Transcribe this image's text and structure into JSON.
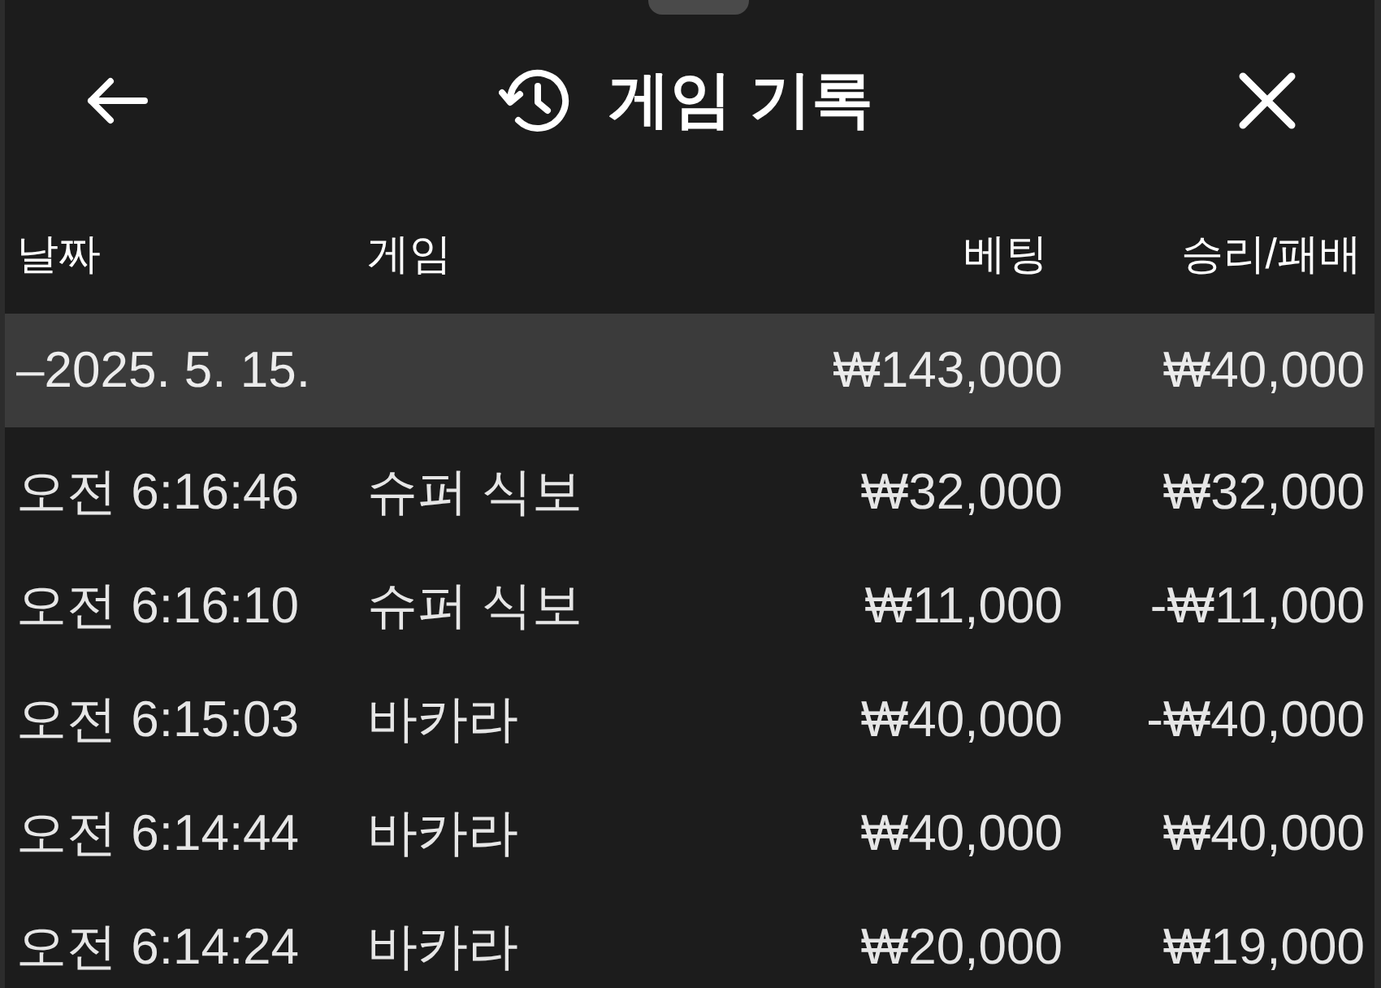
{
  "header": {
    "title": "게임 기록"
  },
  "table": {
    "columns": [
      "날짜",
      "게임",
      "베팅",
      "승리/패배"
    ],
    "groups": [
      {
        "date": "–2025. 5. 15.",
        "bet_total": "₩143,000",
        "result_total": "₩40,000",
        "expanded": true,
        "rows": [
          {
            "time": "오전 6:16:46",
            "game": "슈퍼 식보",
            "bet": "₩32,000",
            "result": "₩32,000"
          },
          {
            "time": "오전 6:16:10",
            "game": "슈퍼 식보",
            "bet": "₩11,000",
            "result": "-₩11,000"
          },
          {
            "time": "오전 6:15:03",
            "game": "바카라",
            "bet": "₩40,000",
            "result": "-₩40,000"
          },
          {
            "time": "오전 6:14:44",
            "game": "바카라",
            "bet": "₩40,000",
            "result": "₩40,000"
          },
          {
            "time": "오전 6:14:24",
            "game": "바카라",
            "bet": "₩20,000",
            "result": "₩19,000"
          }
        ]
      }
    ]
  }
}
